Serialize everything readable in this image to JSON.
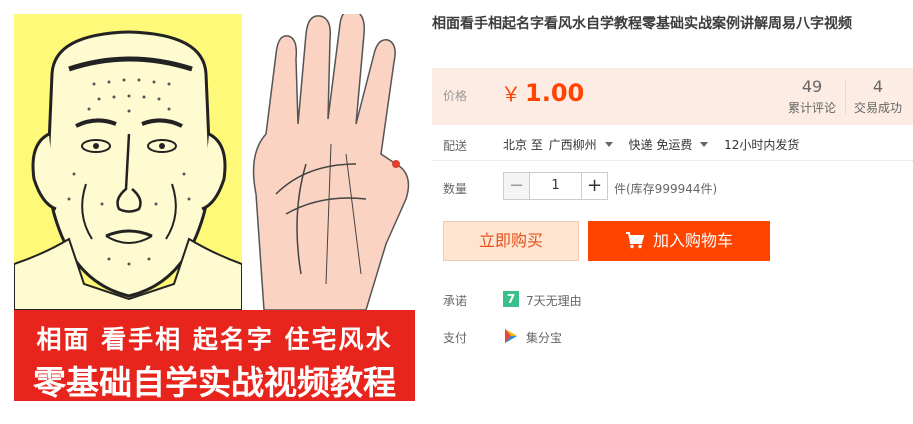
{
  "product": {
    "title": "相面看手相起名字看风水自学教程零基础实战案例讲解周易八字视频",
    "image": {
      "banner_line1": "相面  看手相  起名字  住宅风水",
      "banner_line2": "零基础自学实战视频教程"
    }
  },
  "price": {
    "label": "价格",
    "currency": "￥",
    "value": "1.00",
    "reviews_count": "49",
    "reviews_label": "累计评论",
    "deals_count": "4",
    "deals_label": "交易成功"
  },
  "shipping": {
    "label": "配送",
    "from": "北京 至",
    "to": "广西柳州",
    "method": "快递 免运费",
    "dispatch": "12小时内发货"
  },
  "quantity": {
    "label": "数量",
    "minus": "−",
    "value": "1",
    "plus": "+",
    "stock": "件(库存999944件)"
  },
  "actions": {
    "buy_now": "立即购买",
    "add_to_cart": "加入购物车"
  },
  "promise": {
    "label": "承诺",
    "icon_text": "7",
    "text": "7天无理由"
  },
  "payment": {
    "label": "支付",
    "method": "集分宝"
  },
  "colors": {
    "accent": "#ff4400",
    "price": "#ff4400",
    "price_bg": "#fcece3",
    "promise_icon": "#3bbf8b"
  }
}
